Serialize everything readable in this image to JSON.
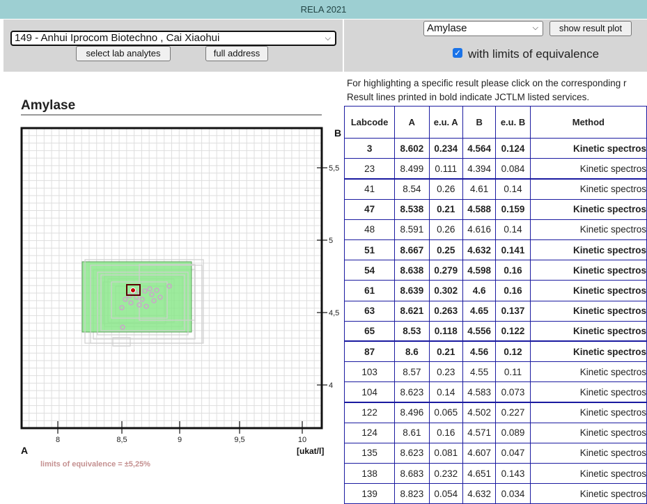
{
  "header": {
    "title": "RELA 2021"
  },
  "lab_selector": {
    "selected": "149 - Anhui Iprocom Biotechno , Cai Xiaohui"
  },
  "buttons": {
    "select_lab_analytes": "select lab analytes",
    "full_address": "full address",
    "show_result_plot": "show result plot"
  },
  "analyte_selector": {
    "selected": "Amylase"
  },
  "limits_checkbox": {
    "label": "with limits of equivalence",
    "checked": true
  },
  "info": {
    "line1": "For highlighting a specific result please click on the corresponding r",
    "line2": "Result lines printed in bold indicate JCTLM listed services."
  },
  "plot": {
    "title": "Amylase",
    "label_a": "A",
    "label_b": "B",
    "unit": "[ukat/l]",
    "limits_text": "limits of equivalence = ±5,25%",
    "x_ticks": [
      "8",
      "8,5",
      "9",
      "9,5",
      "10"
    ],
    "y_ticks": [
      "5,5",
      "5",
      "4,5",
      "4"
    ],
    "colors": {
      "limits_fill": "#8ce88c",
      "grid": "#dcdcdc",
      "highlight": "#b00000",
      "limits_text": "#c49090"
    }
  },
  "table": {
    "columns": [
      "Labcode",
      "A",
      "e.u. A",
      "B",
      "e.u. B",
      "Method"
    ],
    "rows": [
      {
        "labcode": "3",
        "a": "8.602",
        "eua": "0.234",
        "b": "4.564",
        "eub": "0.124",
        "method": "Kinetic spectros",
        "bold": true
      },
      {
        "labcode": "23",
        "a": "8.499",
        "eua": "0.111",
        "b": "4.394",
        "eub": "0.084",
        "method": "Kinetic spectros",
        "bold": false
      },
      {
        "labcode": "41",
        "a": "8.54",
        "eua": "0.26",
        "b": "4.61",
        "eub": "0.14",
        "method": "Kinetic spectros",
        "bold": false
      },
      {
        "labcode": "47",
        "a": "8.538",
        "eua": "0.21",
        "b": "4.588",
        "eub": "0.159",
        "method": "Kinetic spectros",
        "bold": true
      },
      {
        "labcode": "48",
        "a": "8.591",
        "eua": "0.26",
        "b": "4.616",
        "eub": "0.14",
        "method": "Kinetic spectros",
        "bold": false
      },
      {
        "labcode": "51",
        "a": "8.667",
        "eua": "0.25",
        "b": "4.632",
        "eub": "0.141",
        "method": "Kinetic spectros",
        "bold": true
      },
      {
        "labcode": "54",
        "a": "8.638",
        "eua": "0.279",
        "b": "4.598",
        "eub": "0.16",
        "method": "Kinetic spectros",
        "bold": true
      },
      {
        "labcode": "61",
        "a": "8.639",
        "eua": "0.302",
        "b": "4.6",
        "eub": "0.16",
        "method": "Kinetic spectros",
        "bold": true
      },
      {
        "labcode": "63",
        "a": "8.621",
        "eua": "0.263",
        "b": "4.65",
        "eub": "0.137",
        "method": "Kinetic spectros",
        "bold": true
      },
      {
        "labcode": "65",
        "a": "8.53",
        "eua": "0.118",
        "b": "4.556",
        "eub": "0.122",
        "method": "Kinetic spectros",
        "bold": true
      },
      {
        "labcode": "87",
        "a": "8.6",
        "eua": "0.21",
        "b": "4.56",
        "eub": "0.12",
        "method": "Kinetic spectros",
        "bold": true
      },
      {
        "labcode": "103",
        "a": "8.57",
        "eua": "0.23",
        "b": "4.55",
        "eub": "0.11",
        "method": "Kinetic spectros",
        "bold": false
      },
      {
        "labcode": "104",
        "a": "8.623",
        "eua": "0.14",
        "b": "4.583",
        "eub": "0.073",
        "method": "Kinetic spectros",
        "bold": false
      },
      {
        "labcode": "122",
        "a": "8.496",
        "eua": "0.065",
        "b": "4.502",
        "eub": "0.227",
        "method": "Kinetic spectros",
        "bold": false
      },
      {
        "labcode": "124",
        "a": "8.61",
        "eua": "0.16",
        "b": "4.571",
        "eub": "0.089",
        "method": "Kinetic spectros",
        "bold": false
      },
      {
        "labcode": "135",
        "a": "8.623",
        "eua": "0.081",
        "b": "4.607",
        "eub": "0.047",
        "method": "Kinetic spectros",
        "bold": false
      },
      {
        "labcode": "138",
        "a": "8.683",
        "eua": "0.232",
        "b": "4.651",
        "eub": "0.143",
        "method": "Kinetic spectros",
        "bold": false
      },
      {
        "labcode": "139",
        "a": "8.823",
        "eua": "0.054",
        "b": "4.632",
        "eub": "0.034",
        "method": "Kinetic spectros",
        "bold": false
      }
    ]
  }
}
